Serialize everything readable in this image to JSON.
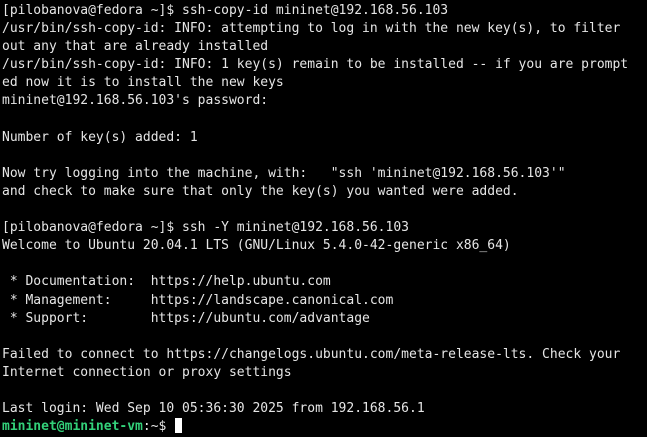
{
  "terminal": {
    "lines": [
      "[pilobanova@fedora ~]$ ssh-copy-id mininet@192.168.56.103",
      "/usr/bin/ssh-copy-id: INFO: attempting to log in with the new key(s), to filter",
      "out any that are already installed",
      "/usr/bin/ssh-copy-id: INFO: 1 key(s) remain to be installed -- if you are prompt",
      "ed now it is to install the new keys",
      "mininet@192.168.56.103's password:",
      "",
      "Number of key(s) added: 1",
      "",
      "Now try logging into the machine, with:   \"ssh 'mininet@192.168.56.103'\"",
      "and check to make sure that only the key(s) you wanted were added.",
      "",
      "[pilobanova@fedora ~]$ ssh -Y mininet@192.168.56.103",
      "Welcome to Ubuntu 20.04.1 LTS (GNU/Linux 5.4.0-42-generic x86_64)",
      "",
      " * Documentation:  https://help.ubuntu.com",
      " * Management:     https://landscape.canonical.com",
      " * Support:        https://ubuntu.com/advantage",
      "",
      "Failed to connect to https://changelogs.ubuntu.com/meta-release-lts. Check your",
      "Internet connection or proxy settings",
      "",
      "Last login: Wed Sep 10 05:36:30 2025 from 192.168.56.1"
    ],
    "prompt": {
      "user_host": "mininet@mininet-vm",
      "separator": ":",
      "path_and_symbol": "~$ "
    }
  },
  "colors": {
    "background": "#000000",
    "text": "#e6e6e6",
    "prompt_green": "#33d17a"
  }
}
